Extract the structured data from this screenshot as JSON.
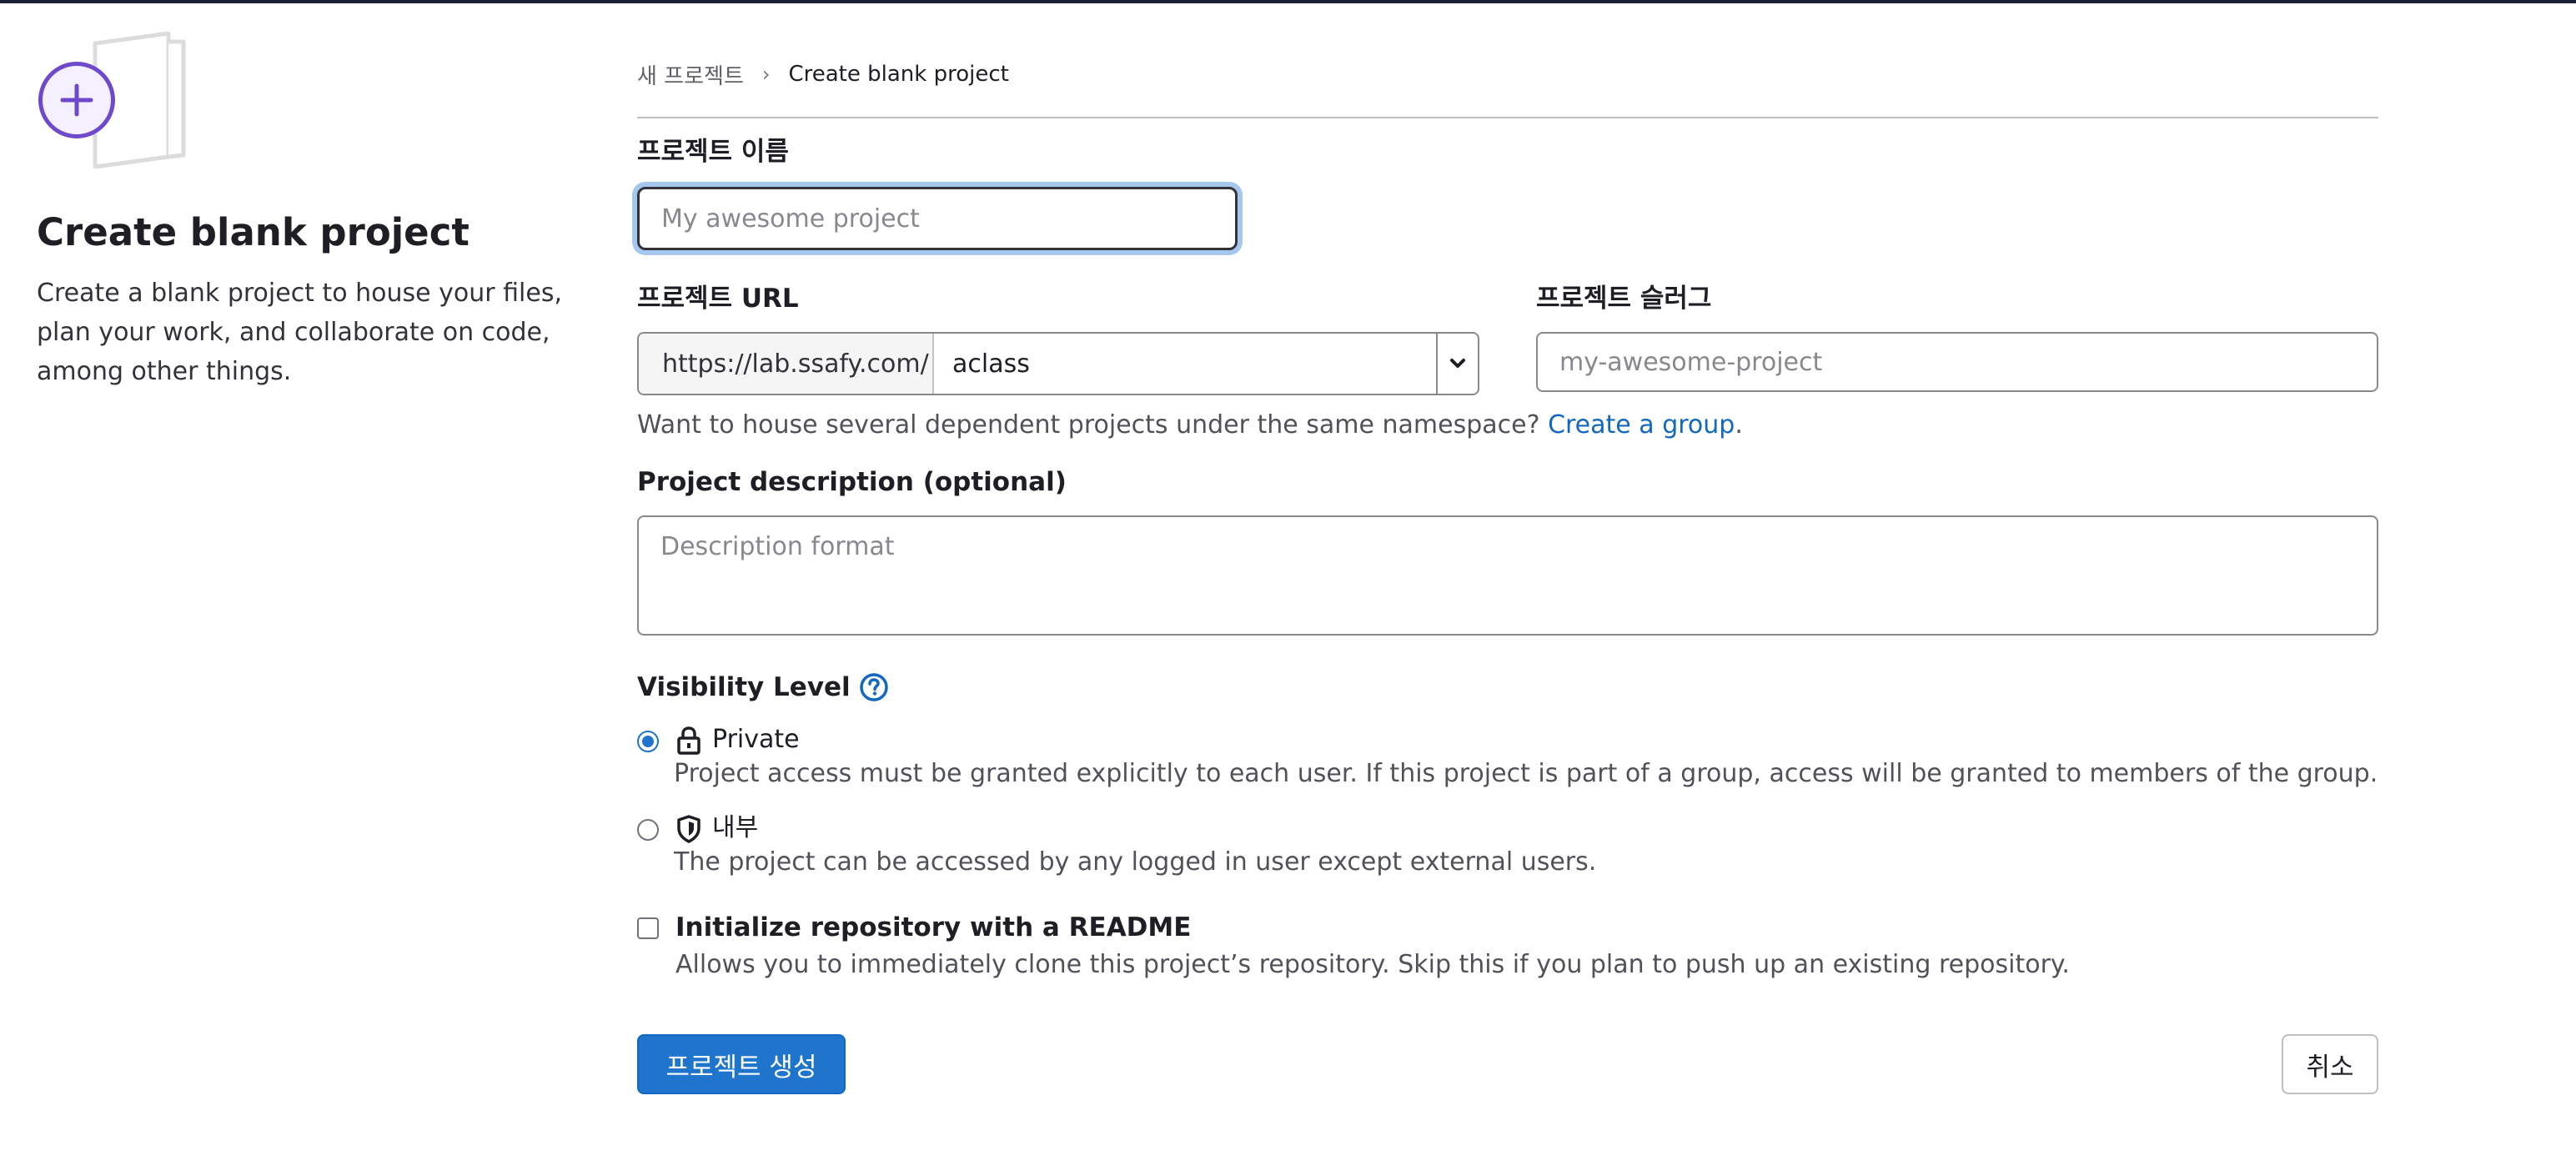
{
  "breadcrumb": {
    "parent": "새 프로젝트",
    "separator": "›",
    "current": "Create blank project"
  },
  "left_panel": {
    "title": "Create blank project",
    "description": "Create a blank project to house your files, plan your work, and collaborate on code, among other things."
  },
  "form": {
    "project_name": {
      "label": "프로젝트 이름",
      "placeholder": "My awesome project",
      "value": ""
    },
    "project_url": {
      "label": "프로젝트 URL",
      "prefix": "https://lab.ssafy.com/",
      "namespace": "aclass"
    },
    "project_slug": {
      "label": "프로젝트 슬러그",
      "placeholder": "my-awesome-project"
    },
    "namespace_help": {
      "text": "Want to house several dependent projects under the same namespace?",
      "link": "Create a group",
      "suffix": "."
    },
    "description": {
      "label": "Project description (optional)",
      "placeholder": "Description format"
    },
    "visibility": {
      "label": "Visibility Level",
      "options": [
        {
          "title": "Private",
          "description": "Project access must be granted explicitly to each user. If this project is part of a group, access will be granted to members of the group.",
          "icon": "lock-icon",
          "selected": true
        },
        {
          "title": "내부",
          "description": "The project can be accessed by any logged in user except external users.",
          "icon": "shield-icon",
          "selected": false
        }
      ]
    },
    "readme": {
      "label": "Initialize repository with a README",
      "description": "Allows you to immediately clone this project’s repository. Skip this if you plan to push up an existing repository.",
      "checked": false
    },
    "buttons": {
      "create": "프로젝트 생성",
      "cancel": "취소"
    }
  },
  "colors": {
    "primary": "#1f75cb",
    "link": "#1068bf",
    "illustration_purple": "#6e49cb"
  }
}
